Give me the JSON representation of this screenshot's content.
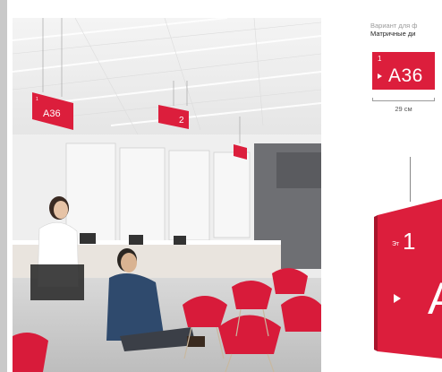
{
  "photo": {
    "ceiling_sign_1": "A36",
    "ceiling_sign_1_floor": "1",
    "ceiling_sign_2": "2"
  },
  "right_panel": {
    "variant_caption": "Вариант для ф",
    "variant_title": "Матричные ди",
    "small_sign": {
      "floor": "1",
      "code": "A36"
    },
    "dimension_label": "29 см",
    "large_sign": {
      "floor_prefix": "Эт",
      "floor": "1",
      "code_fragment": "A"
    },
    "accent_color": "#dc1e3c"
  }
}
